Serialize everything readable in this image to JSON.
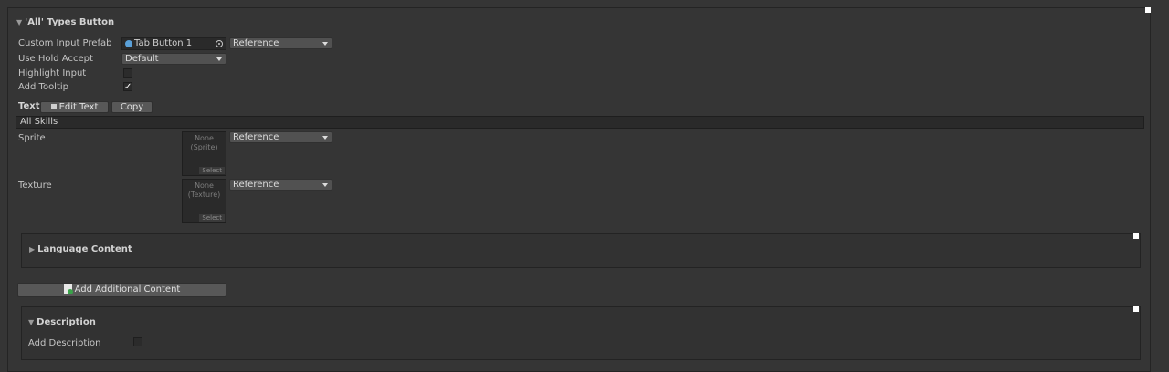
{
  "section_title": "'All' Types Button",
  "custom_input_prefab": {
    "label": "Custom Input Prefab",
    "value": "Tab Button 1",
    "mode": "Reference"
  },
  "use_hold_accept": {
    "label": "Use Hold Accept",
    "value": "Default"
  },
  "highlight_input": {
    "label": "Highlight Input",
    "checked": false
  },
  "add_tooltip": {
    "label": "Add Tooltip",
    "checked": true,
    "check_glyph": "✓"
  },
  "text": {
    "label": "Text",
    "edit_button": "Edit Text",
    "copy_button": "Copy",
    "value": "All Skills"
  },
  "sprite": {
    "label": "Sprite",
    "placeholder": "None (Sprite)",
    "select": "Select",
    "mode": "Reference"
  },
  "texture": {
    "label": "Texture",
    "placeholder_line1": "None",
    "placeholder_line2": "(Texture)",
    "select": "Select",
    "mode": "Reference"
  },
  "language_content": {
    "label": "Language Content"
  },
  "add_additional_content": {
    "label": "Add Additional Content"
  },
  "description": {
    "title": "Description",
    "add_label": "Add Description",
    "checked": false
  },
  "glyphs": {
    "expanded": "▼",
    "collapsed": "▶"
  },
  "colors": {
    "background": "#353535",
    "field": "#2a2a2a",
    "button": "#585858",
    "dropdown": "#515151"
  }
}
